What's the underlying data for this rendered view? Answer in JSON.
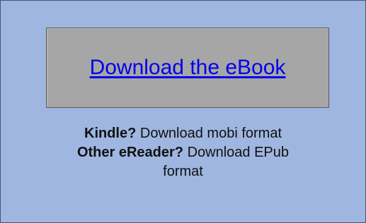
{
  "download": {
    "link_text": "Download the eBook"
  },
  "formats": {
    "kindle_label": "Kindle?",
    "kindle_text": "Download mobi format",
    "other_label": "Other eReader?",
    "other_text_line1": "Download EPub",
    "other_text_line2": "format"
  },
  "colors": {
    "panel_background": "#9fb6e0",
    "box_background": "#a6a6a6",
    "link": "#0000ee"
  }
}
